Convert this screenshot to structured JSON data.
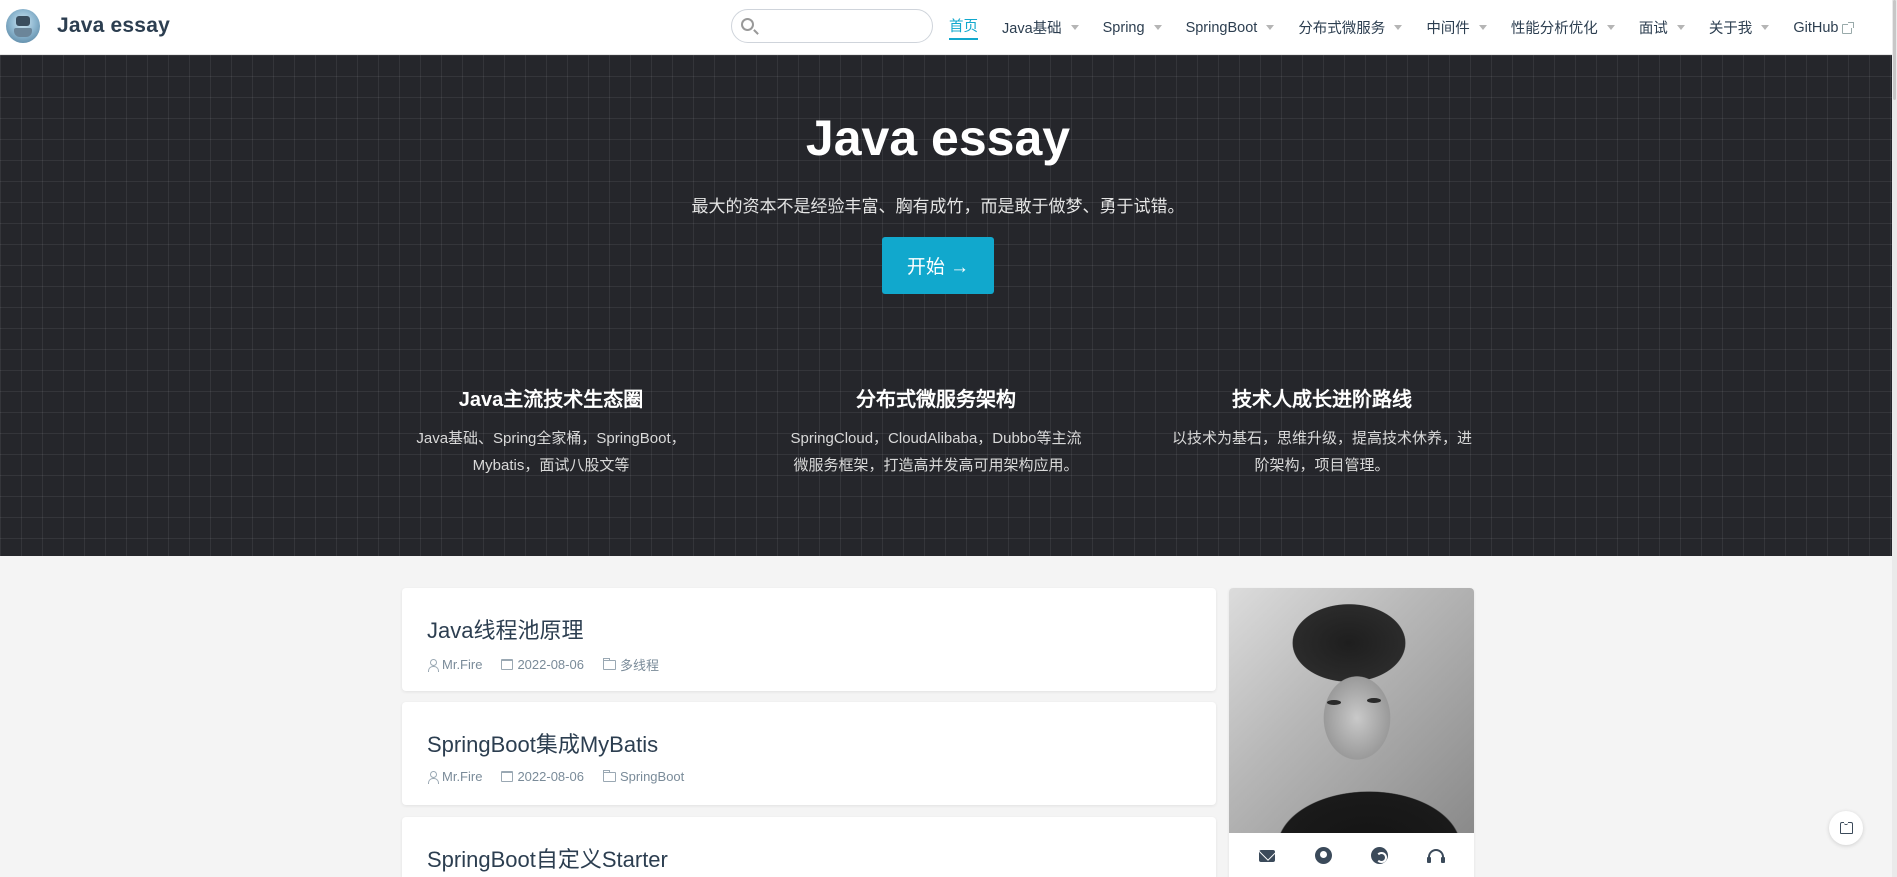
{
  "navbar": {
    "site_title": "Java essay",
    "search": {
      "value": "",
      "placeholder": ""
    },
    "links": [
      {
        "label": "首页",
        "active": true,
        "dropdown": false,
        "external": false
      },
      {
        "label": "Java基础",
        "active": false,
        "dropdown": true,
        "external": false
      },
      {
        "label": "Spring",
        "active": false,
        "dropdown": true,
        "external": false
      },
      {
        "label": "SpringBoot",
        "active": false,
        "dropdown": true,
        "external": false
      },
      {
        "label": "分布式微服务",
        "active": false,
        "dropdown": true,
        "external": false
      },
      {
        "label": "中间件",
        "active": false,
        "dropdown": true,
        "external": false
      },
      {
        "label": "性能分析优化",
        "active": false,
        "dropdown": true,
        "external": false
      },
      {
        "label": "面试",
        "active": false,
        "dropdown": true,
        "external": false
      },
      {
        "label": "关于我",
        "active": false,
        "dropdown": true,
        "external": false
      },
      {
        "label": "GitHub",
        "active": false,
        "dropdown": false,
        "external": true
      }
    ]
  },
  "hero": {
    "title": "Java essay",
    "tagline": "最大的资本不是经验丰富、胸有成竹，而是敢于做梦、勇于试错。",
    "start_button": "开始 →",
    "features": [
      {
        "title": "Java主流技术生态圈",
        "description": "Java基础、Spring全家桶，SpringBoot，Mybatis，面试八股文等"
      },
      {
        "title": "分布式微服务架构",
        "description": "SpringCloud，CloudAlibaba，Dubbo等主流微服务框架，打造高并发高可用架构应用。"
      },
      {
        "title": "技术人成长进阶路线",
        "description": "以技术为基石，思维升级，提高技术休养，进阶架构，项目管理。"
      }
    ]
  },
  "posts": [
    {
      "title": "Java线程池原理",
      "author": "Mr.Fire",
      "date": "2022-08-06",
      "category": "多线程"
    },
    {
      "title": "SpringBoot集成MyBatis",
      "author": "Mr.Fire",
      "date": "2022-08-06",
      "category": "SpringBoot"
    },
    {
      "title": "SpringBoot自定义Starter",
      "author": "",
      "date": "",
      "category": ""
    }
  ],
  "sidebar": {
    "social_icons": [
      "mail-icon",
      "github-icon",
      "gitee-icon",
      "headphones-icon"
    ]
  },
  "colors": {
    "accent": "#11a8cd",
    "hero_bg": "#25262b",
    "text": "#2c3e50"
  }
}
